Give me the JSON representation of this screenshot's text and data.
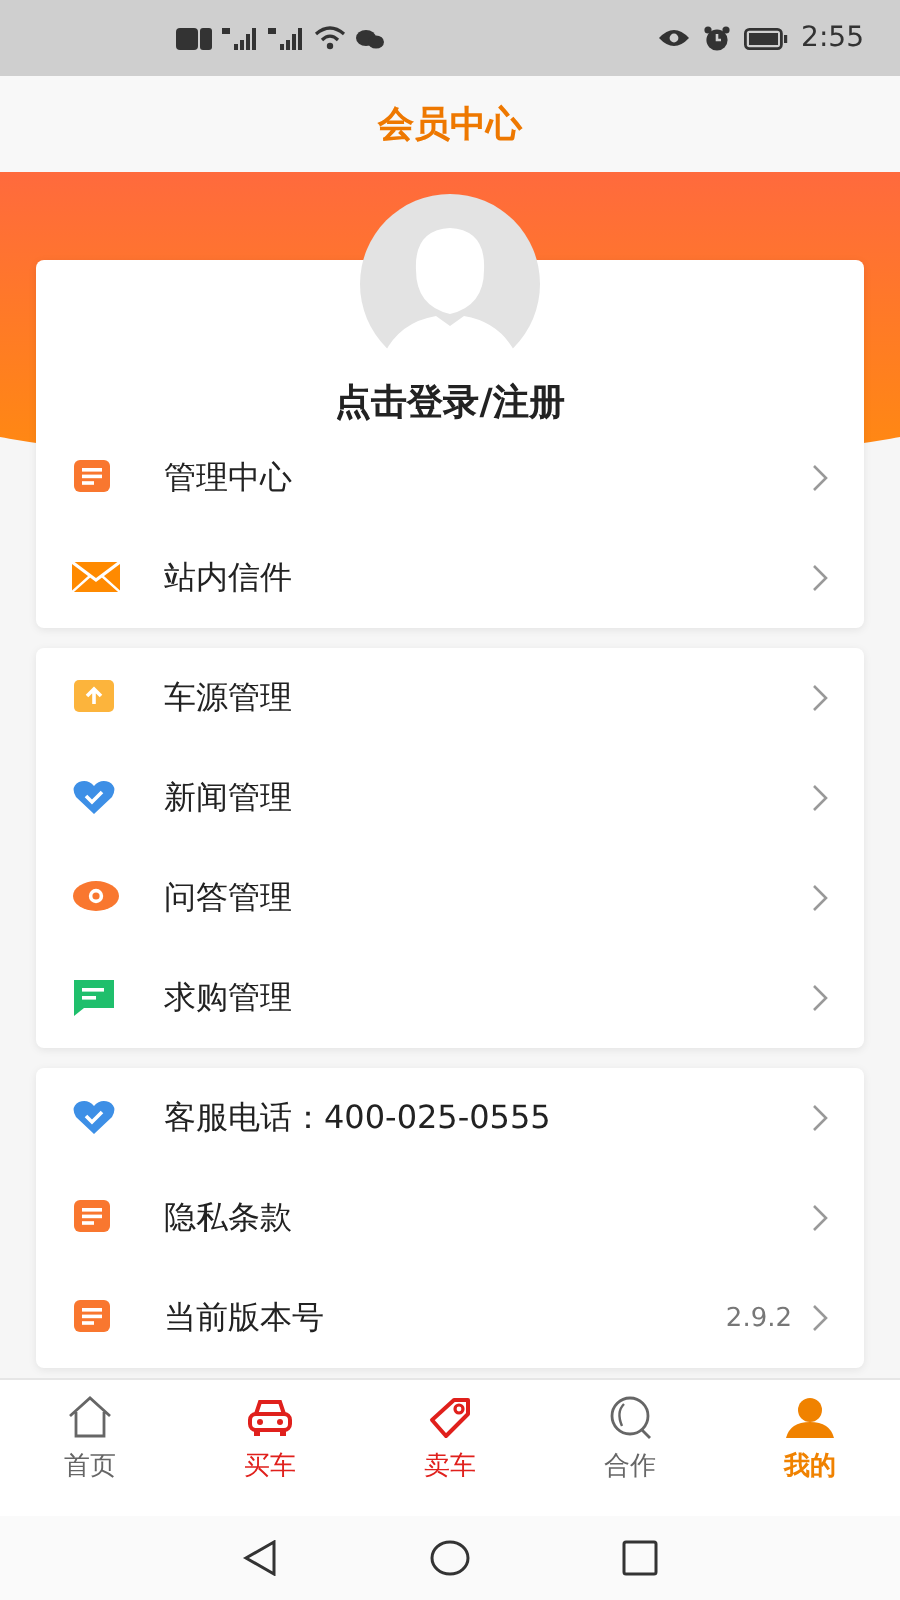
{
  "status_bar": {
    "time": "2:55"
  },
  "header": {
    "title": "会员中心"
  },
  "profile": {
    "login_label": "点击登录/注册"
  },
  "groups": [
    {
      "items": [
        {
          "kind": "doc",
          "label": "管理中心"
        },
        {
          "kind": "mail",
          "label": "站内信件"
        }
      ]
    },
    {
      "items": [
        {
          "kind": "upload",
          "label": "车源管理"
        },
        {
          "kind": "heart",
          "label": "新闻管理"
        },
        {
          "kind": "eye",
          "label": "问答管理"
        },
        {
          "kind": "chat",
          "label": "求购管理"
        }
      ]
    },
    {
      "items": [
        {
          "kind": "heart",
          "label": "客服电话：400-025-0555"
        },
        {
          "kind": "doc",
          "label": "隐私条款"
        },
        {
          "kind": "doc",
          "label": "当前版本号",
          "value": "2.9.2"
        }
      ]
    }
  ],
  "tabs": [
    {
      "kind": "home",
      "label": "首页",
      "color": "#666666",
      "selected": false
    },
    {
      "kind": "car",
      "label": "买车",
      "color": "#e0201c",
      "selected": false
    },
    {
      "kind": "tag",
      "label": "卖车",
      "color": "#e0201c",
      "selected": false
    },
    {
      "kind": "chat",
      "label": "合作",
      "color": "#666666",
      "selected": false
    },
    {
      "kind": "user",
      "label": "我的",
      "color": "#f08200",
      "selected": true
    }
  ]
}
